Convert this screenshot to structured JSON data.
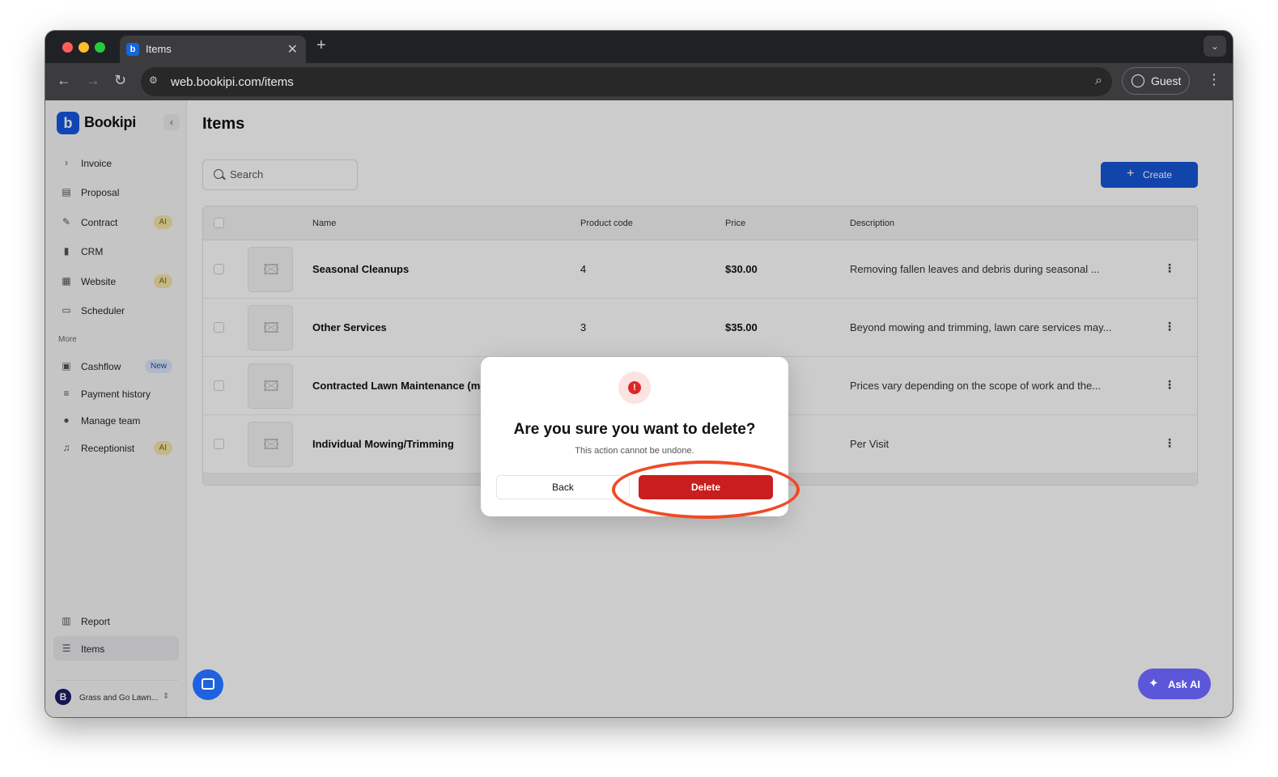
{
  "browser": {
    "tab_title": "Items",
    "tab_favicon": "b",
    "url": "web.bookipi.com/items",
    "profile_label": "Guest"
  },
  "sidebar": {
    "brand": "Bookipi",
    "items": [
      {
        "label": "Invoice",
        "icon": "chevron-right-icon"
      },
      {
        "label": "Proposal",
        "icon": "proposal-icon"
      },
      {
        "label": "Contract",
        "icon": "contract-icon",
        "badge": "AI"
      },
      {
        "label": "CRM",
        "icon": "crm-icon"
      },
      {
        "label": "Website",
        "icon": "website-icon",
        "badge": "AI"
      },
      {
        "label": "Scheduler",
        "icon": "calendar-icon"
      }
    ],
    "more_label": "More",
    "more_items": [
      {
        "label": "Cashflow",
        "icon": "cashflow-icon",
        "badge": "New"
      },
      {
        "label": "Payment history",
        "icon": "payment-history-icon"
      },
      {
        "label": "Manage team",
        "icon": "team-icon"
      },
      {
        "label": "Receptionist",
        "icon": "headset-icon",
        "badge": "AI"
      }
    ],
    "bottom_items": [
      {
        "label": "Report",
        "icon": "bar-chart-icon"
      },
      {
        "label": "Items",
        "icon": "items-icon"
      }
    ],
    "org_name": "Grass and Go Lawn...",
    "org_initial": "B"
  },
  "main": {
    "title": "Items",
    "search_placeholder": "Search",
    "create_label": "Create",
    "columns": {
      "name": "Name",
      "code": "Product code",
      "price": "Price",
      "description": "Description"
    },
    "rows": [
      {
        "name": "Seasonal Cleanups",
        "code": "4",
        "price": "$30.00",
        "description": "Removing fallen leaves and debris during seasonal ..."
      },
      {
        "name": "Other Services",
        "code": "3",
        "price": "$35.00",
        "description": "Beyond mowing and trimming, lawn care services may..."
      },
      {
        "name": "Contracted Lawn Maintenance (mo",
        "code": "",
        "price": "",
        "description": "Prices vary depending on the scope of work and the..."
      },
      {
        "name": "Individual Mowing/Trimming",
        "code": "",
        "price": "",
        "description": "Per Visit"
      }
    ]
  },
  "dialog": {
    "title": "Are you sure you want to delete?",
    "subtitle": "This action cannot be undone.",
    "back_label": "Back",
    "delete_label": "Delete",
    "icon_glyph": "!"
  },
  "ask_ai_label": "Ask AI",
  "colors": {
    "primary": "#1757d6",
    "danger": "#c81e1e",
    "annotation": "#f04a25",
    "ask_ai": "#5b57d8"
  }
}
